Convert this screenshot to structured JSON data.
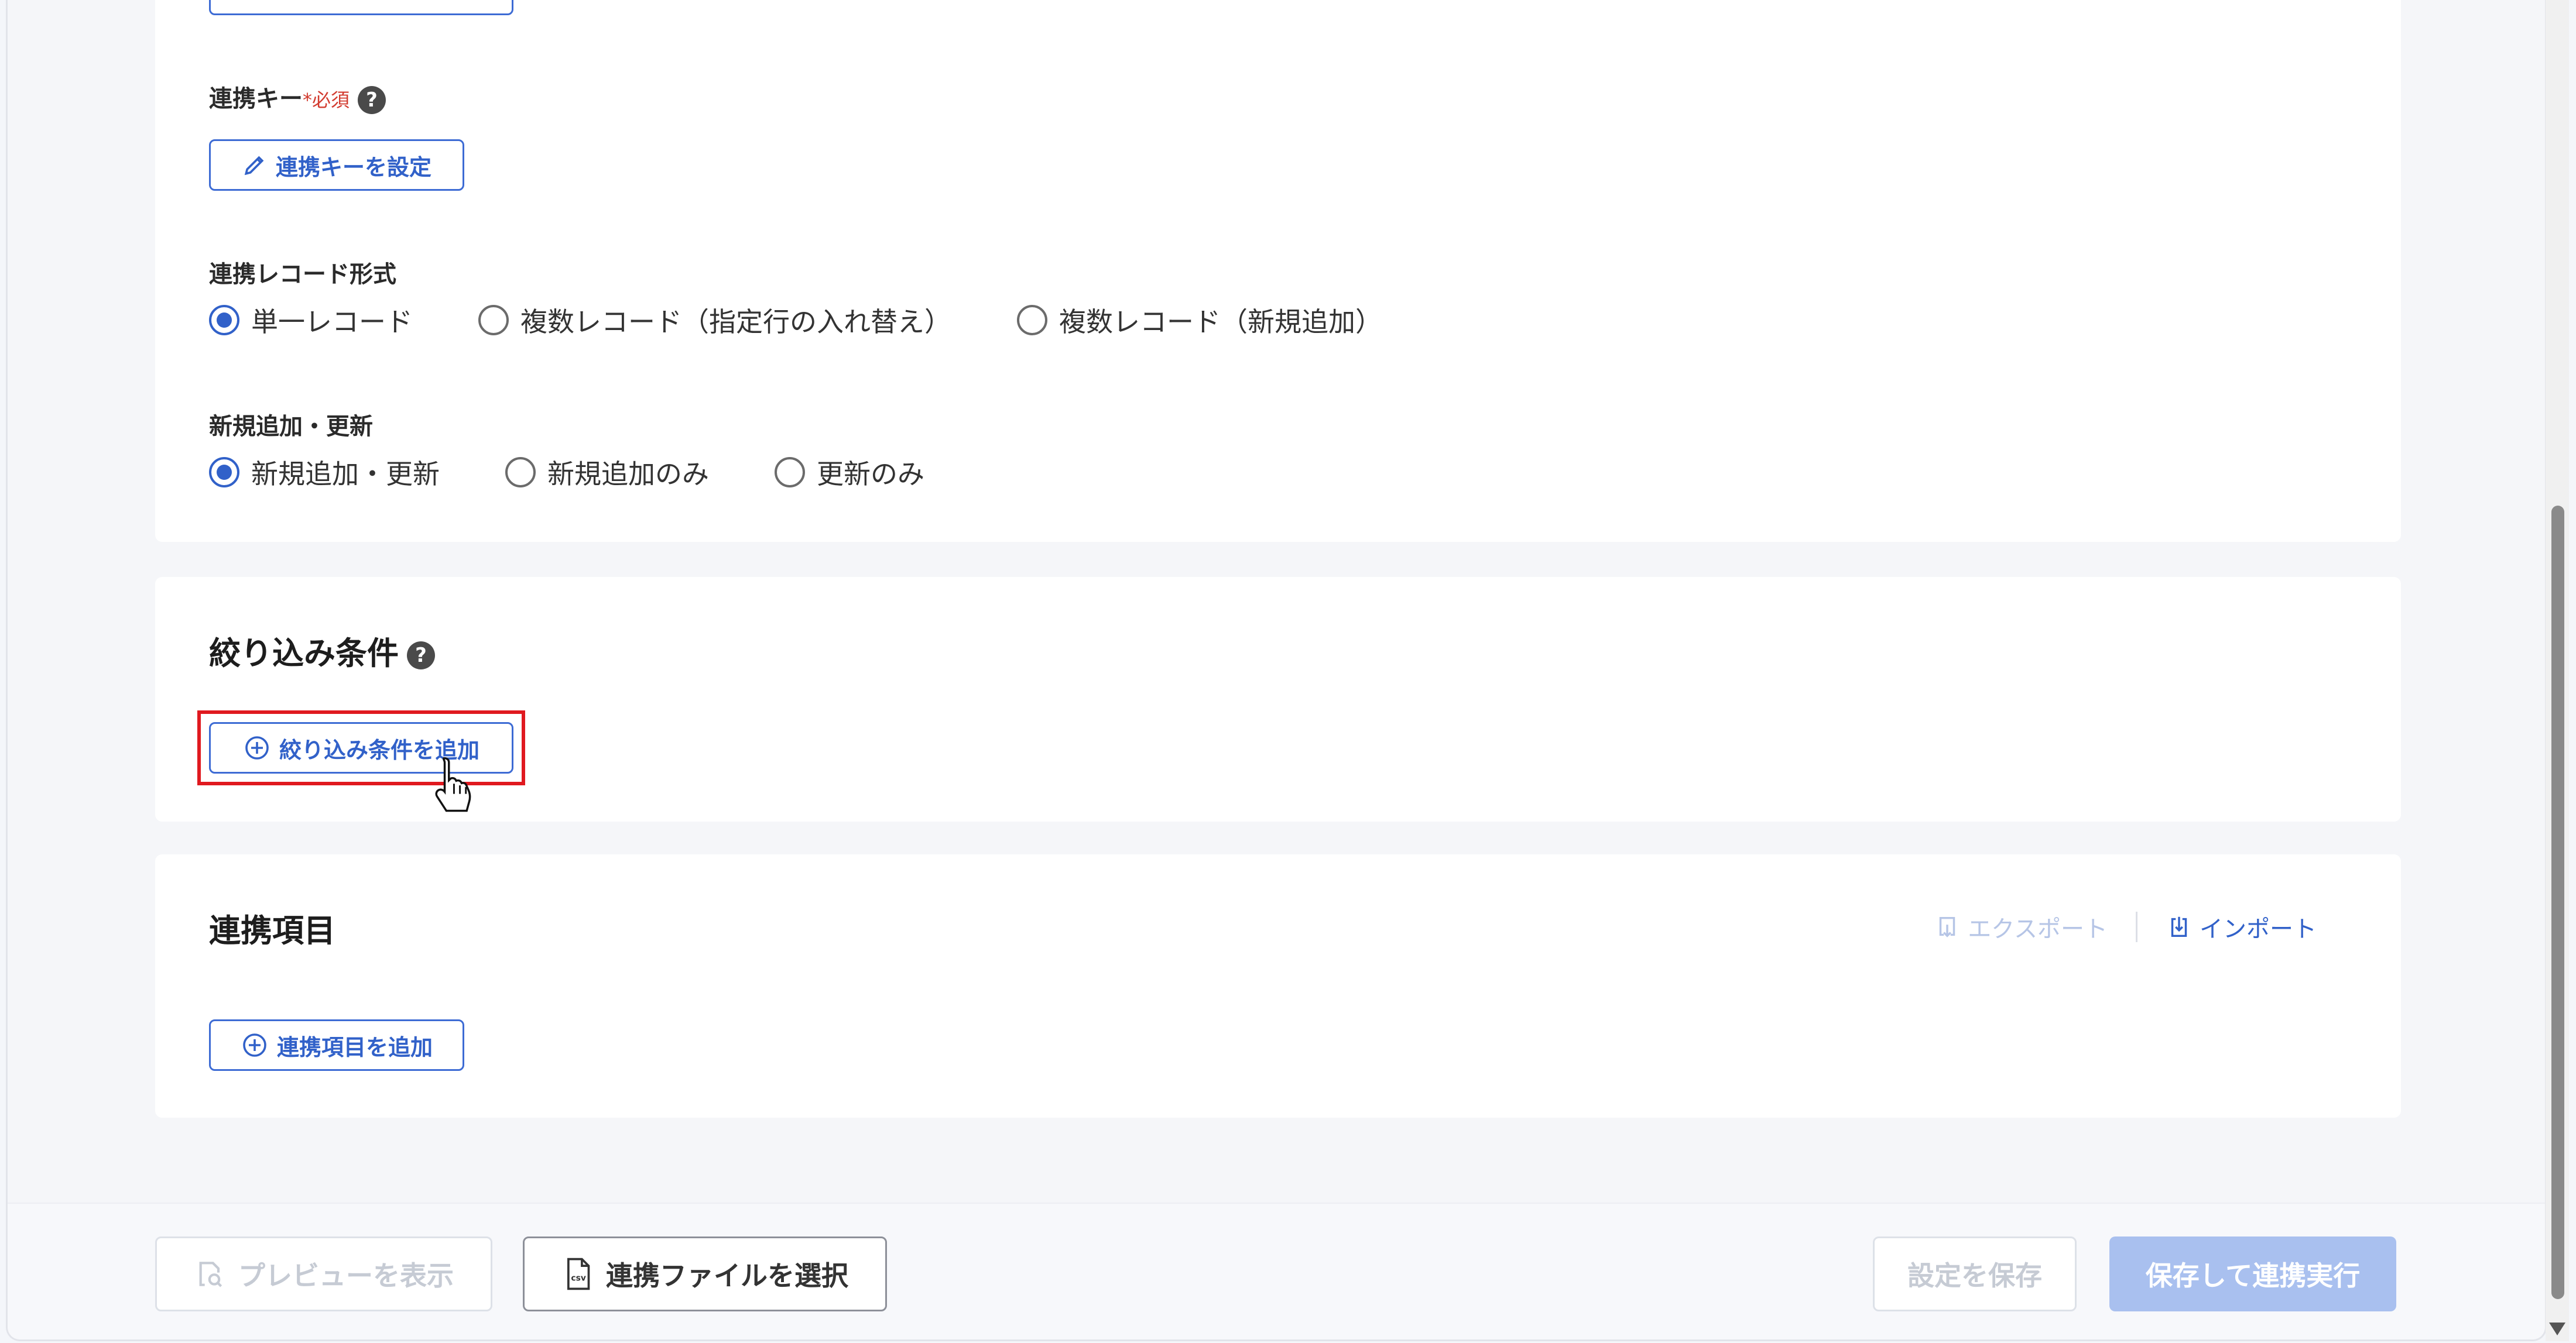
{
  "integration_key": {
    "label": "連携キー",
    "required_mark": "*",
    "required_text": "必須",
    "help": "?",
    "button_label": "連携キーを設定",
    "button_icon": "pencil-icon"
  },
  "record_format": {
    "label": "連携レコード形式",
    "options": [
      {
        "label": "単一レコード",
        "checked": true
      },
      {
        "label": "複数レコード（指定行の入れ替え）",
        "checked": false
      },
      {
        "label": "複数レコード（新規追加）",
        "checked": false
      }
    ]
  },
  "add_update": {
    "label": "新規追加・更新",
    "options": [
      {
        "label": "新規追加・更新",
        "checked": true
      },
      {
        "label": "新規追加のみ",
        "checked": false
      },
      {
        "label": "更新のみ",
        "checked": false
      }
    ]
  },
  "filter": {
    "title": "絞り込み条件",
    "help": "?",
    "button_label": "絞り込み条件を追加",
    "button_icon": "plus-circle-icon"
  },
  "fields": {
    "title": "連携項目",
    "export_label": "エクスポート",
    "import_label": "インポート",
    "button_label": "連携項目を追加",
    "button_icon": "plus-circle-icon"
  },
  "footer": {
    "preview_label": "プレビューを表示",
    "select_file_label": "連携ファイルを選択",
    "file_icon_text": "csv",
    "save_label": "設定を保存",
    "save_run_label": "保存して連携実行"
  },
  "colors": {
    "accent": "#3161c9",
    "required": "#d23b2f",
    "highlight": "#e0191f",
    "disabled_solid": "#a9c0ef"
  }
}
